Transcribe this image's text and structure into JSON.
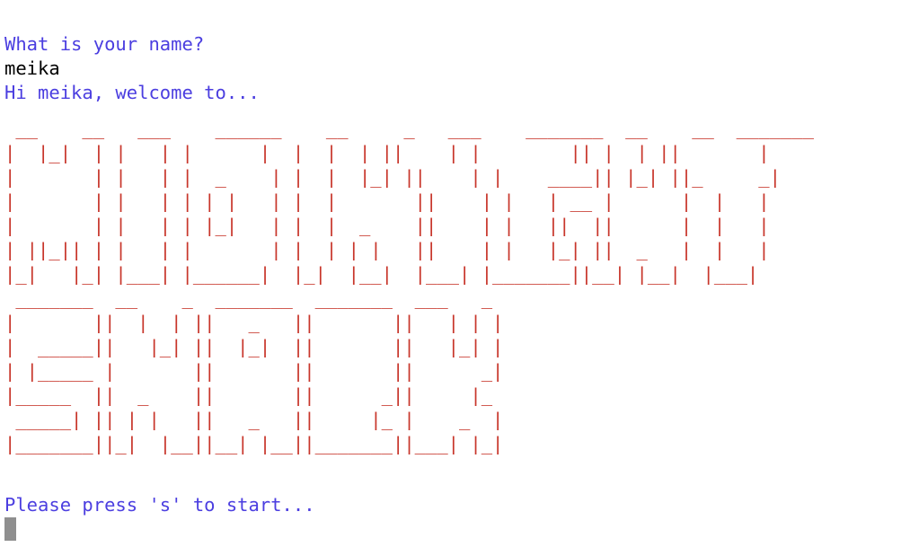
{
  "terminal": {
    "question": "What is your name?",
    "answer": "meika",
    "greeting": "Hi meika, welcome to...",
    "prompt_start": "Please press 's' to start..."
  },
  "banner": {
    "word1": [
      " __    __   ___    ______    __     _   ___    _______  __    __  _______",
      "|  |_|  | |   | |      |  |  |  | ||    | |        || |  | ||       |",
      "|       | |   | |  _    | |  |  |_| ||    | |    ____|| |_| ||_     _|",
      "|       | |   | | | |   | |  |       ||    | |   | __ |      |  |   |",
      "|       | |   | | |_|   | |  |  _    ||    | |   ||  ||      |  |   |",
      "| ||_|| | |   | |       | |  | | |   ||    | |   |_| ||  _   |  |   |",
      "|_|   |_| |___| |______|  |_|  |__|  |___| |_______||__| |__|  |___|"
    ],
    "word2": [
      " _______  __    _  _______  _______  ___   _",
      "|       ||  |  | ||   _   ||       ||   | | |",
      "|  _____||   |_| ||  |_|  ||       ||   |_| |",
      "| |_____ |       ||       ||       ||      _|",
      "|_____  ||  _    ||       ||      _||     |_",
      " _____| || | |   ||   _   ||     |_ |    _  |",
      "|_______||_|  |__||__| |__||_______||___| |_|"
    ]
  },
  "colors": {
    "prompt": "#4b3ee0",
    "banner": "#c8362b",
    "input": "#000000",
    "cursor": "#8f8f8f"
  }
}
